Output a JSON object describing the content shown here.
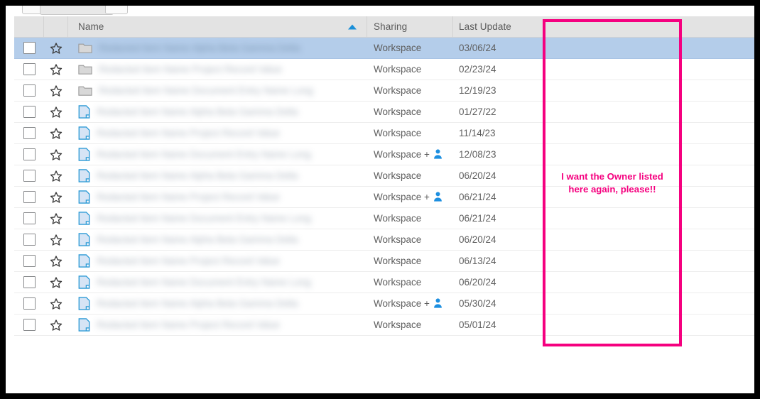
{
  "window": {
    "toolbar_chips": [
      "",
      "",
      ""
    ]
  },
  "table": {
    "columns": [
      {
        "key": "checkbox",
        "label": ""
      },
      {
        "key": "star",
        "label": ""
      },
      {
        "key": "name",
        "label": "Name",
        "sorted": "ascending"
      },
      {
        "key": "sharing",
        "label": "Sharing"
      },
      {
        "key": "updated",
        "label": "Last Update"
      }
    ],
    "sort_indicator": "ascending-triangle",
    "rows": [
      {
        "type": "folder",
        "name": "",
        "sharing": "Workspace",
        "shared_with_person": false,
        "updated": "03/06/24",
        "selected": true,
        "starred": false,
        "checked": false
      },
      {
        "type": "folder",
        "name": "",
        "sharing": "Workspace",
        "shared_with_person": false,
        "updated": "02/23/24",
        "selected": false,
        "starred": false,
        "checked": false
      },
      {
        "type": "folder",
        "name": "",
        "sharing": "Workspace",
        "shared_with_person": false,
        "updated": "12/19/23",
        "selected": false,
        "starred": false,
        "checked": false
      },
      {
        "type": "document",
        "name": "",
        "sharing": "Workspace",
        "shared_with_person": false,
        "updated": "01/27/22",
        "selected": false,
        "starred": false,
        "checked": false
      },
      {
        "type": "document",
        "name": "",
        "sharing": "Workspace",
        "shared_with_person": false,
        "updated": "11/14/23",
        "selected": false,
        "starred": false,
        "checked": false
      },
      {
        "type": "document",
        "name": "",
        "sharing": "Workspace + ",
        "shared_with_person": true,
        "updated": "12/08/23",
        "selected": false,
        "starred": false,
        "checked": false
      },
      {
        "type": "document",
        "name": "",
        "sharing": "Workspace",
        "shared_with_person": false,
        "updated": "06/20/24",
        "selected": false,
        "starred": false,
        "checked": false
      },
      {
        "type": "document",
        "name": "",
        "sharing": "Workspace + ",
        "shared_with_person": true,
        "updated": "06/21/24",
        "selected": false,
        "starred": false,
        "checked": false
      },
      {
        "type": "document",
        "name": "",
        "sharing": "Workspace",
        "shared_with_person": false,
        "updated": "06/21/24",
        "selected": false,
        "starred": false,
        "checked": false
      },
      {
        "type": "document",
        "name": "",
        "sharing": "Workspace",
        "shared_with_person": false,
        "updated": "06/20/24",
        "selected": false,
        "starred": false,
        "checked": false
      },
      {
        "type": "document",
        "name": "",
        "sharing": "Workspace",
        "shared_with_person": false,
        "updated": "06/13/24",
        "selected": false,
        "starred": false,
        "checked": false
      },
      {
        "type": "document",
        "name": "",
        "sharing": "Workspace",
        "shared_with_person": false,
        "updated": "06/20/24",
        "selected": false,
        "starred": false,
        "checked": false
      },
      {
        "type": "document",
        "name": "",
        "sharing": "Workspace + ",
        "shared_with_person": true,
        "updated": "05/30/24",
        "selected": false,
        "starred": false,
        "checked": false
      },
      {
        "type": "document",
        "name": "",
        "sharing": "Workspace",
        "shared_with_person": false,
        "updated": "05/01/24",
        "selected": false,
        "starred": false,
        "checked": false
      }
    ]
  },
  "annotation": {
    "text": "I want the Owner listed here again, please!!",
    "color": "#f5007f"
  },
  "colors": {
    "header_bg": "#e3e3e3",
    "selected_row": "#b4cdea",
    "sort_arrow": "#1a8fd8",
    "doc_icon": "#2e9bd6",
    "person_icon": "#1d8fe0",
    "annotation": "#f5007f"
  }
}
